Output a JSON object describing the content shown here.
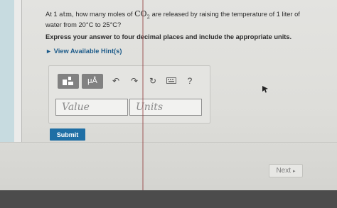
{
  "question": {
    "line1_prefix": "At 1",
    "line1_unit": "atm",
    "line1_mid": ", how many moles of",
    "line1_chem_main": "CO",
    "line1_chem_sub": "2",
    "line1_suffix": "are released by raising the temperature of 1 liter of",
    "line2_prefix": "water from",
    "temp_start": "20°C",
    "line2_mid": "to",
    "temp_end": "25°C",
    "line2_suffix": "?"
  },
  "instruction": "Express your answer to four decimal places and include the appropriate units.",
  "hints": {
    "label": "View Available Hint(s)"
  },
  "toolbar": {
    "templates_icon": "templates-icon",
    "units_button_label": "μÅ",
    "undo_icon": "undo-icon",
    "redo_icon": "redo-icon",
    "reset_icon": "reset-icon",
    "keyboard_icon": "keyboard-icon",
    "help_label": "?"
  },
  "answer": {
    "value_placeholder": "Value",
    "units_placeholder": "Units"
  },
  "submit_label": "Submit",
  "next_label": "Next",
  "colors": {
    "primary": "#1f6fa5",
    "toolbar_button": "#818181",
    "hint_link": "#1d5b8a"
  }
}
